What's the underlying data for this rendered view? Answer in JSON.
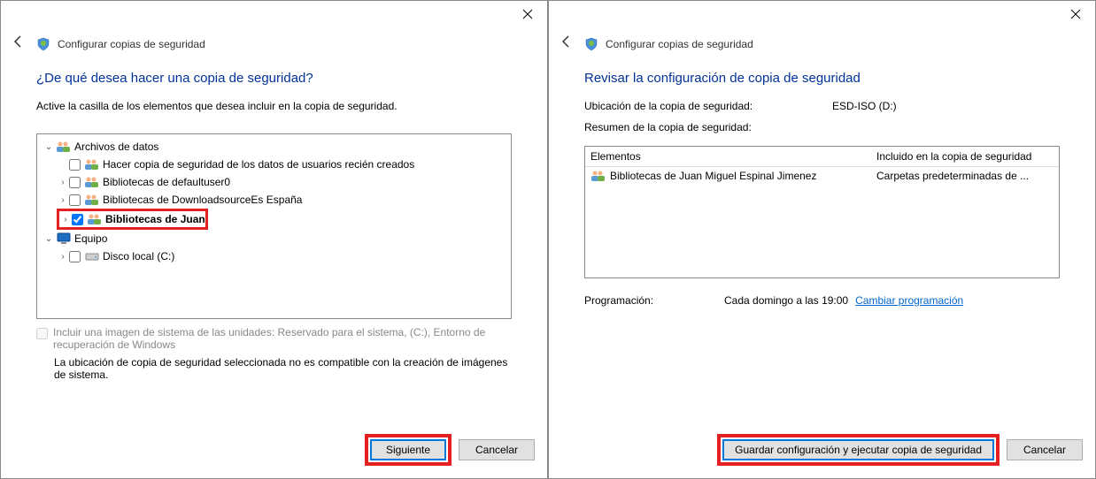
{
  "left": {
    "header": "Configurar copias de seguridad",
    "title": "¿De qué desea hacer una copia de seguridad?",
    "instruction": "Active la casilla de los elementos que desea incluir en la copia de seguridad.",
    "tree": {
      "root": "Archivos de datos",
      "item1": "Hacer copia de seguridad de los datos de usuarios recién creados",
      "item2": "Bibliotecas de defaultuser0",
      "item3": "Bibliotecas de DownloadsourceEs España",
      "item4": "Bibliotecas de Juan",
      "equipo": "Equipo",
      "disk": "Disco local (C:)"
    },
    "disabled_checkbox": "Incluir una imagen de sistema de las unidades: Reservado para el sistema, (C:), Entorno de recuperación de Windows",
    "warning": "La ubicación de copia de seguridad seleccionada no es compatible con la creación de imágenes de sistema.",
    "btn_next": "Siguiente",
    "btn_cancel": "Cancelar"
  },
  "right": {
    "header": "Configurar copias de seguridad",
    "title": "Revisar la configuración de copia de seguridad",
    "location_label": "Ubicación de la copia de seguridad:",
    "location_value": "ESD-ISO (D:)",
    "summary_label": "Resumen de la copia de seguridad:",
    "col_elements": "Elementos",
    "col_included": "Incluido en la copia de seguridad",
    "list_item_name": "Bibliotecas de Juan Miguel Espinal Jimenez",
    "list_item_value": "Carpetas predeterminadas de ...",
    "schedule_label": "Programación:",
    "schedule_value": "Cada domingo a las 19:00",
    "schedule_link": "Cambiar programación",
    "btn_save": "Guardar configuración y ejecutar copia de seguridad",
    "btn_cancel": "Cancelar"
  }
}
